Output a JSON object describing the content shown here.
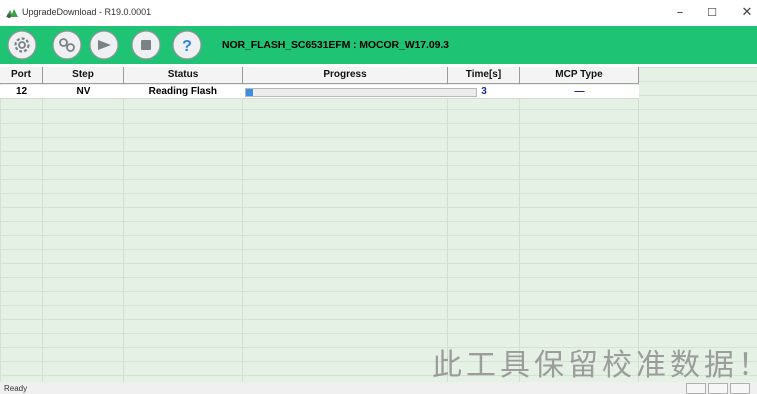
{
  "window": {
    "title": "UpgradeDownload - R19.0.0001",
    "minimize": "–",
    "maximize": "☐",
    "close": "✕"
  },
  "toolbar": {
    "buttons": [
      {
        "name": "settings",
        "icon": "gear-icon"
      },
      {
        "name": "load-packet",
        "icon": "link-icon"
      },
      {
        "name": "start",
        "icon": "play-icon"
      },
      {
        "name": "stop",
        "icon": "stop-icon"
      },
      {
        "name": "help",
        "icon": "question-icon",
        "label": "?"
      }
    ],
    "firmware": "NOR_FLASH_SC6531EFM : MOCOR_W17.09.3",
    "accent": "#1fc374"
  },
  "table": {
    "columns": [
      "Port",
      "Step",
      "Status",
      "Progress",
      "Time[s]",
      "MCP Type"
    ],
    "rows": [
      {
        "port": "12",
        "step": "NV",
        "status": "Reading Flash",
        "progress": 0.03,
        "time": "3",
        "mcp_type": "—"
      }
    ]
  },
  "watermark": "此工具保留校准数据！",
  "statusbar": {
    "text": "Ready"
  }
}
